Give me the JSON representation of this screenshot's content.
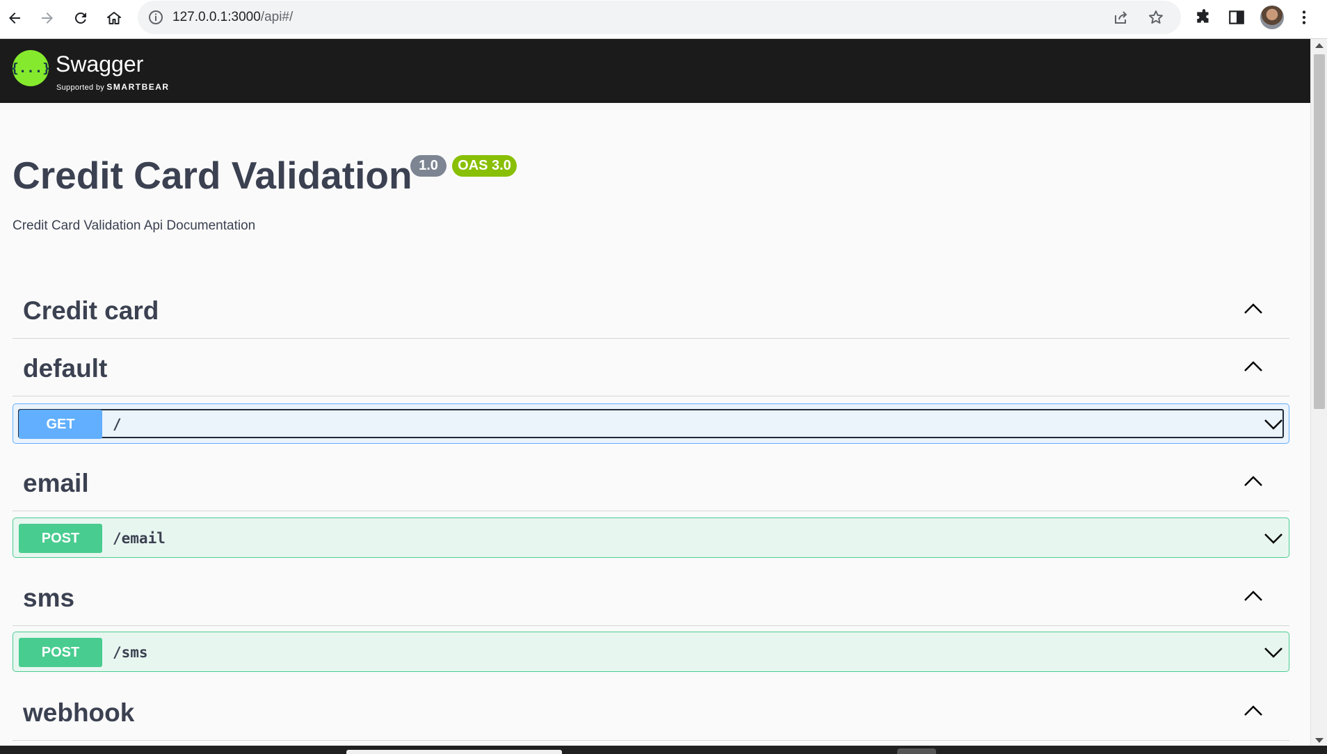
{
  "browser": {
    "url_host": "127.0.0.1:3000",
    "url_path": "/api#/"
  },
  "topbar": {
    "logo_glyph": "{...}",
    "logo_name": "Swagger",
    "logo_supported_by": "Supported by",
    "logo_brand": "SMARTBEAR"
  },
  "info": {
    "title": "Credit Card Validation",
    "version": "1.0",
    "oas": "OAS 3.0",
    "description": "Credit Card Validation Api Documentation"
  },
  "tags": [
    {
      "name": "Credit card",
      "operations": []
    },
    {
      "name": "default",
      "operations": [
        {
          "method": "GET",
          "path": "/"
        }
      ]
    },
    {
      "name": "email",
      "operations": [
        {
          "method": "POST",
          "path": "/email"
        }
      ]
    },
    {
      "name": "sms",
      "operations": [
        {
          "method": "POST",
          "path": "/sms"
        }
      ]
    },
    {
      "name": "webhook",
      "operations": []
    }
  ],
  "colors": {
    "get": "#61affe",
    "post": "#49cc90",
    "logo": "#85ea2d",
    "version_badge": "#7d8492",
    "oas_badge": "#89bf04"
  },
  "icons": {
    "browser": [
      "back-arrow-icon",
      "forward-arrow-icon",
      "reload-icon",
      "home-icon",
      "info-icon",
      "share-icon",
      "star-icon",
      "extensions-icon",
      "side-panel-icon",
      "menu-dots-icon"
    ],
    "tag_toggle": "chevron-up-icon",
    "operation_toggle": "chevron-down-icon"
  }
}
